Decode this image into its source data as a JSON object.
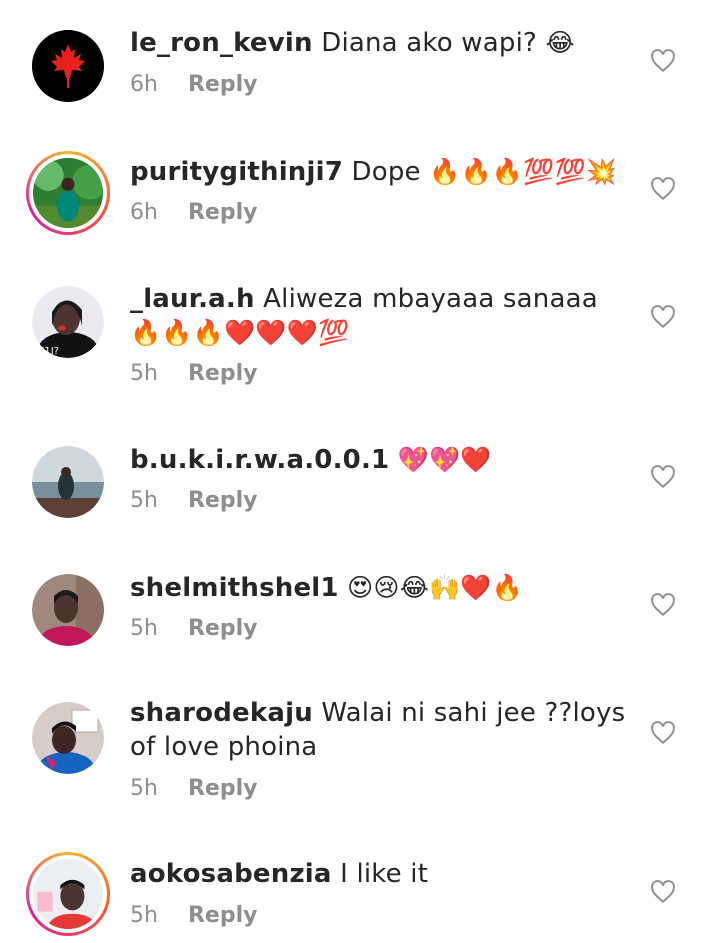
{
  "reply_label": "Reply",
  "comments": [
    {
      "username": "le_ron_kevin",
      "text": "Diana ako wapi?",
      "emoji": "😂",
      "time": "6h"
    },
    {
      "username": "puritygithinji7",
      "text": "Dope",
      "emoji": "🔥🔥🔥💯💯💥",
      "time": "6h"
    },
    {
      "username": "_laur.a.h",
      "text": "Aliweza mbayaaa sanaaa",
      "emoji": "🔥🔥🔥❤️❤️❤️💯",
      "time": "5h"
    },
    {
      "username": "b.u.k.i.r.w.a.0.0.1",
      "text": "",
      "emoji": "💖💖❤️",
      "time": "5h"
    },
    {
      "username": "shelmithshel1",
      "text": "",
      "emoji": "😍😢😂🙌❤️🔥",
      "time": "5h"
    },
    {
      "username": "sharodekaju",
      "text": "Walai ni sahi jee ??loys of love phoina",
      "emoji": "",
      "time": "5h"
    },
    {
      "username": "aokosabenzia",
      "text": "I like it",
      "emoji": "",
      "time": "5h"
    }
  ],
  "icons": {
    "like": "heart-outline-icon",
    "canada": "maple-leaf-icon"
  },
  "colors": {
    "secondary_text": "#8e8e8e",
    "story_ring_start": "#f7b531",
    "story_ring_end": "#d6249f"
  }
}
